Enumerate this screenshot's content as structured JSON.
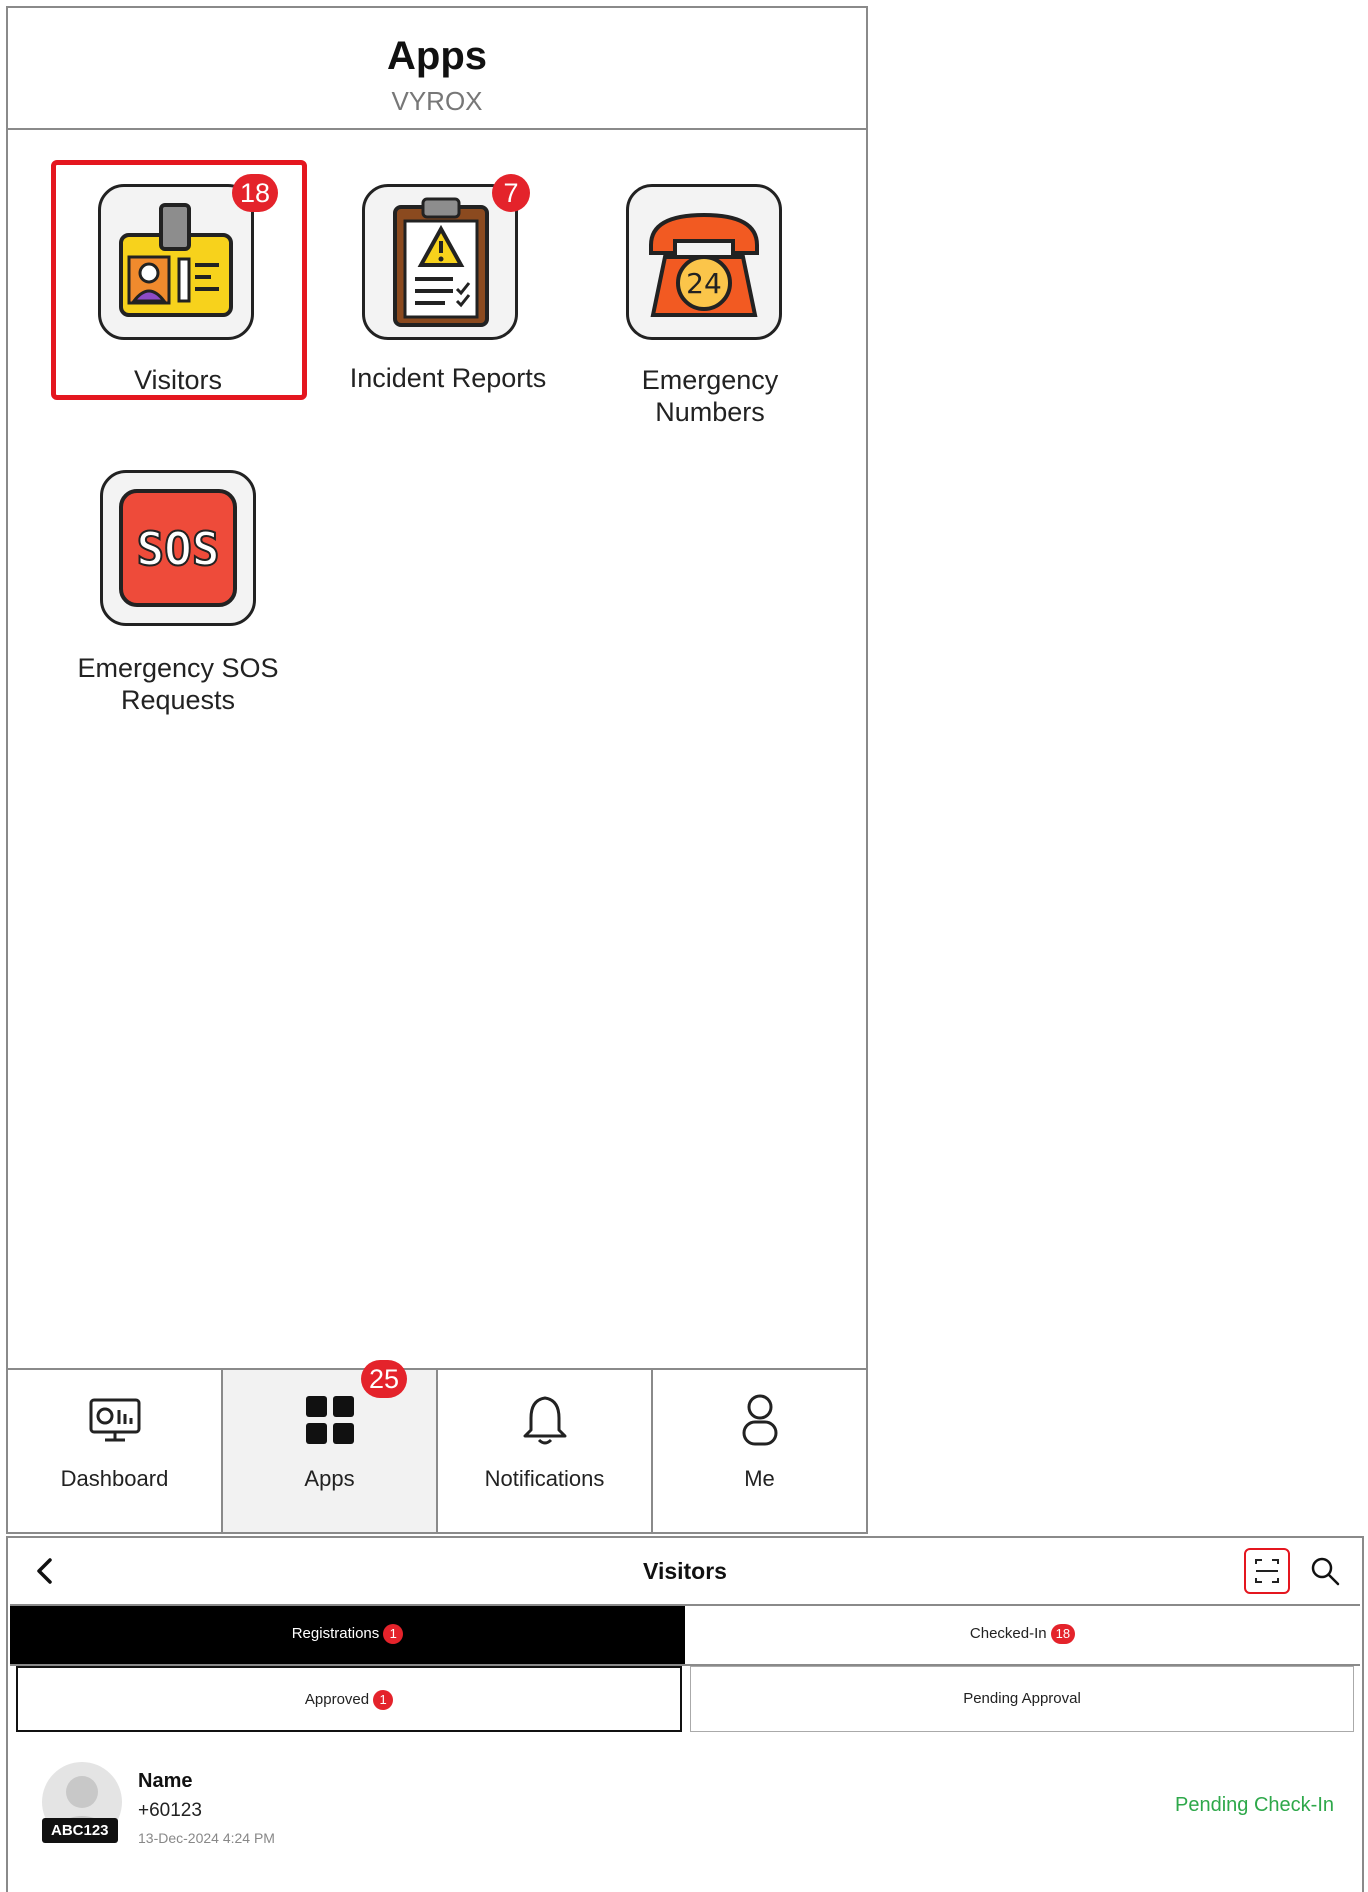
{
  "apps_screen": {
    "title": "Apps",
    "subtitle": "VYROX",
    "tiles": [
      {
        "label": "Visitors",
        "badge": "18",
        "icon": "visitor-id-card-icon"
      },
      {
        "label": "Incident Reports",
        "badge": "7",
        "icon": "incident-clipboard-icon"
      },
      {
        "label": "Emergency\nNumbers",
        "badge": "",
        "icon": "emergency-phone-24-icon"
      },
      {
        "label": "Emergency SOS\nRequests",
        "badge": "",
        "icon": "sos-icon"
      }
    ],
    "bottom_nav": [
      {
        "label": "Dashboard",
        "icon": "dashboard-monitor-icon",
        "badge": ""
      },
      {
        "label": "Apps",
        "icon": "apps-grid-icon",
        "badge": "25",
        "active": true
      },
      {
        "label": "Notifications",
        "icon": "bell-icon",
        "badge": ""
      },
      {
        "label": "Me",
        "icon": "user-icon",
        "badge": ""
      }
    ]
  },
  "visitors_screen": {
    "title": "Visitors",
    "tabs": [
      {
        "label": "Registrations",
        "badge": "1",
        "active": true
      },
      {
        "label": "Checked-In",
        "badge": "18",
        "active": false
      }
    ],
    "subtabs": [
      {
        "label": "Approved",
        "badge": "1",
        "active": true
      },
      {
        "label": "Pending Approval",
        "badge": "",
        "active": false
      }
    ],
    "visitor": {
      "name": "Name",
      "phone": "+60123",
      "datetime": "13-Dec-2024 4:24 PM",
      "plate": "ABC123",
      "status": "Pending Check-In"
    }
  },
  "colors": {
    "badge_red": "#e4232b",
    "selection_red": "#e4161f",
    "status_green": "#2ea84a"
  }
}
